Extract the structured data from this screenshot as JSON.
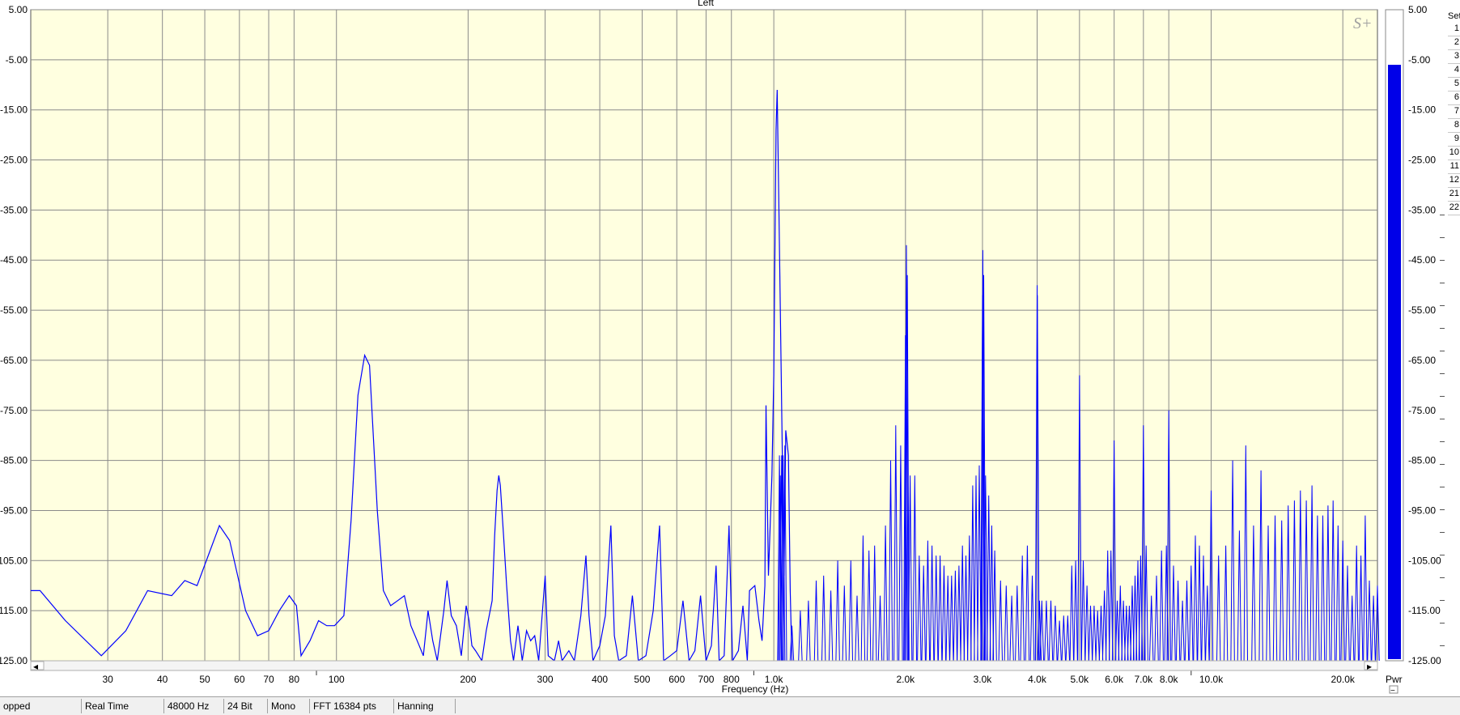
{
  "window": {
    "channel_title": "Left"
  },
  "logo": {
    "text": "S+"
  },
  "set_panel": {
    "label": "Set",
    "buttons": [
      "1",
      "2",
      "3",
      "4",
      "5",
      "6",
      "7",
      "8",
      "9",
      "10",
      "11",
      "12",
      "21",
      "22"
    ]
  },
  "meter": {
    "label": "Pwr",
    "level_db": -6.0,
    "collapse_glyph": "−"
  },
  "scroll": {
    "left_arrow": "◂",
    "right_arrow": "▸"
  },
  "status": {
    "segments": [
      "opped",
      "Real Time",
      "48000 Hz",
      "24 Bit",
      "Mono",
      "FFT 16384 pts",
      "Hanning"
    ]
  },
  "colors": {
    "plot_bg": "#ffffe0",
    "trace": "#0000ff",
    "grid": "#8a8a8a",
    "meter_fill": "#0000e8"
  },
  "chart_data": {
    "type": "line",
    "title": "Left",
    "xlabel": "Frequency (Hz)",
    "ylabel": "",
    "x_scale": "log",
    "xlim": [
      20,
      24000
    ],
    "ylim": [
      -125,
      5
    ],
    "x_ticks": [
      {
        "v": 30,
        "t": "30"
      },
      {
        "v": 40,
        "t": "40"
      },
      {
        "v": 50,
        "t": "50"
      },
      {
        "v": 60,
        "t": "60"
      },
      {
        "v": 70,
        "t": "70"
      },
      {
        "v": 80,
        "t": "80"
      },
      {
        "v": 100,
        "t": "100"
      },
      {
        "v": 200,
        "t": "200"
      },
      {
        "v": 300,
        "t": "300"
      },
      {
        "v": 400,
        "t": "400"
      },
      {
        "v": 500,
        "t": "500"
      },
      {
        "v": 600,
        "t": "600"
      },
      {
        "v": 700,
        "t": "700"
      },
      {
        "v": 800,
        "t": "800"
      },
      {
        "v": 1000,
        "t": "1.0k"
      },
      {
        "v": 2000,
        "t": "2.0k"
      },
      {
        "v": 3000,
        "t": "3.0k"
      },
      {
        "v": 4000,
        "t": "4.0k"
      },
      {
        "v": 5000,
        "t": "5.0k"
      },
      {
        "v": 6000,
        "t": "6.0k"
      },
      {
        "v": 7000,
        "t": "7.0k"
      },
      {
        "v": 8000,
        "t": "8.0k"
      },
      {
        "v": 10000,
        "t": "10.0k"
      },
      {
        "v": 20000,
        "t": "20.0k"
      }
    ],
    "x_minor": [
      90,
      900,
      9000
    ],
    "y_ticks": [
      {
        "v": 5,
        "t": "5.00"
      },
      {
        "v": -5,
        "t": "-5.00"
      },
      {
        "v": -15,
        "t": "-15.00"
      },
      {
        "v": -25,
        "t": "-25.00"
      },
      {
        "v": -35,
        "t": "-35.00"
      },
      {
        "v": -45,
        "t": "-45.00"
      },
      {
        "v": -55,
        "t": "-55.00"
      },
      {
        "v": -65,
        "t": "-65.00"
      },
      {
        "v": -75,
        "t": "-75.00"
      },
      {
        "v": -85,
        "t": "-85.00"
      },
      {
        "v": -95,
        "t": "-95.00"
      },
      {
        "v": -105,
        "t": "-105.00"
      },
      {
        "v": -115,
        "t": "-115.00"
      },
      {
        "v": -125,
        "t": "-125.00"
      }
    ],
    "grid": true,
    "series": [
      {
        "points": [
          [
            20,
            -111
          ],
          [
            21,
            -111
          ],
          [
            24,
            -117
          ],
          [
            29,
            -124
          ],
          [
            33,
            -119
          ],
          [
            37,
            -111
          ],
          [
            42,
            -112
          ],
          [
            45,
            -109
          ],
          [
            48,
            -110
          ],
          [
            54,
            -98
          ],
          [
            57,
            -101
          ],
          [
            62,
            -115
          ],
          [
            66,
            -120
          ],
          [
            70,
            -119
          ],
          [
            74,
            -115
          ],
          [
            78,
            -112
          ],
          [
            81,
            -114
          ],
          [
            83,
            -124
          ],
          [
            87,
            -121
          ],
          [
            91,
            -117
          ],
          [
            95,
            -118
          ],
          [
            99,
            -118
          ],
          [
            104,
            -116
          ],
          [
            108,
            -97
          ],
          [
            112,
            -72
          ],
          [
            116,
            -64
          ],
          [
            119,
            -66
          ],
          [
            124,
            -95
          ],
          [
            128,
            -111
          ],
          [
            133,
            -114
          ],
          [
            138,
            -113
          ],
          [
            143,
            -112
          ],
          [
            148,
            -118
          ],
          [
            153,
            -121
          ],
          [
            158,
            -124
          ],
          [
            162,
            -115
          ],
          [
            166,
            -121
          ],
          [
            170,
            -125
          ],
          [
            176,
            -115
          ],
          [
            179,
            -109
          ],
          [
            183,
            -116
          ],
          [
            188,
            -118
          ],
          [
            193,
            -124
          ],
          [
            198,
            -114
          ],
          [
            201,
            -117
          ],
          [
            204,
            -122
          ],
          [
            208,
            -123
          ],
          [
            215,
            -125
          ],
          [
            220,
            -119
          ],
          [
            227,
            -113
          ],
          [
            230,
            -100
          ],
          [
            233,
            -91
          ],
          [
            235,
            -88
          ],
          [
            237,
            -90
          ],
          [
            241,
            -100
          ],
          [
            245,
            -110
          ],
          [
            250,
            -121
          ],
          [
            254,
            -125
          ],
          [
            260,
            -118
          ],
          [
            266,
            -125
          ],
          [
            272,
            -119
          ],
          [
            278,
            -121
          ],
          [
            284,
            -120
          ],
          [
            290,
            -125
          ],
          [
            300,
            -108
          ],
          [
            305,
            -124
          ],
          [
            315,
            -125
          ],
          [
            322,
            -121
          ],
          [
            328,
            -125
          ],
          [
            340,
            -123
          ],
          [
            350,
            -125
          ],
          [
            362,
            -116
          ],
          [
            372,
            -104
          ],
          [
            378,
            -116
          ],
          [
            386,
            -125
          ],
          [
            400,
            -122
          ],
          [
            412,
            -116
          ],
          [
            424,
            -98
          ],
          [
            432,
            -120
          ],
          [
            442,
            -125
          ],
          [
            460,
            -124
          ],
          [
            475,
            -112
          ],
          [
            490,
            -125
          ],
          [
            510,
            -124
          ],
          [
            530,
            -115
          ],
          [
            548,
            -98
          ],
          [
            560,
            -125
          ],
          [
            580,
            -124
          ],
          [
            600,
            -123
          ],
          [
            620,
            -113
          ],
          [
            640,
            -125
          ],
          [
            660,
            -123
          ],
          [
            680,
            -112
          ],
          [
            700,
            -125
          ],
          [
            720,
            -122
          ],
          [
            738,
            -106
          ],
          [
            750,
            -125
          ],
          [
            770,
            -124
          ],
          [
            790,
            -98
          ],
          [
            805,
            -125
          ],
          [
            830,
            -123
          ],
          [
            850,
            -114
          ],
          [
            870,
            -125
          ],
          [
            880,
            -111
          ],
          [
            905,
            -110
          ],
          [
            925,
            -117
          ],
          [
            940,
            -121
          ],
          [
            954,
            -110
          ],
          [
            960,
            -74
          ],
          [
            972,
            -108
          ],
          [
            990,
            -88
          ],
          [
            1000,
            -68
          ],
          [
            1012,
            -19
          ],
          [
            1018,
            -11
          ],
          [
            1026,
            -32
          ],
          [
            1040,
            -68
          ],
          [
            1055,
            -108
          ],
          [
            1065,
            -79
          ],
          [
            1080,
            -84
          ],
          [
            1090,
            -111
          ],
          [
            1100,
            -125
          ]
        ],
        "peaks": [
          [
            1030,
            -84
          ],
          [
            1035,
            -88
          ],
          [
            1042,
            -84
          ],
          [
            1050,
            -84
          ],
          [
            1060,
            -82
          ],
          [
            1100,
            -118
          ],
          [
            1150,
            -115
          ],
          [
            1200,
            -113
          ],
          [
            1250,
            -109
          ],
          [
            1300,
            -108
          ],
          [
            1350,
            -111
          ],
          [
            1400,
            -105
          ],
          [
            1450,
            -110
          ],
          [
            1500,
            -105
          ],
          [
            1550,
            -112
          ],
          [
            1600,
            -100
          ],
          [
            1650,
            -103
          ],
          [
            1700,
            -102
          ],
          [
            1750,
            -112
          ],
          [
            1800,
            -98
          ],
          [
            1850,
            -85
          ],
          [
            1900,
            -78
          ],
          [
            1950,
            -82
          ],
          [
            2000,
            -60
          ],
          [
            2010,
            -42
          ],
          [
            2020,
            -48
          ],
          [
            2050,
            -88
          ],
          [
            2100,
            -88
          ],
          [
            2150,
            -104
          ],
          [
            2200,
            -106
          ],
          [
            2250,
            -101
          ],
          [
            2300,
            -102
          ],
          [
            2350,
            -104
          ],
          [
            2400,
            -104
          ],
          [
            2450,
            -106
          ],
          [
            2500,
            -108
          ],
          [
            2550,
            -108
          ],
          [
            2600,
            -107
          ],
          [
            2650,
            -106
          ],
          [
            2700,
            -102
          ],
          [
            2750,
            -104
          ],
          [
            2800,
            -100
          ],
          [
            2850,
            -90
          ],
          [
            2900,
            -88
          ],
          [
            2950,
            -86
          ],
          [
            3000,
            -52
          ],
          [
            3005,
            -43
          ],
          [
            3020,
            -48
          ],
          [
            3050,
            -88
          ],
          [
            3100,
            -92
          ],
          [
            3150,
            -98
          ],
          [
            3200,
            -103
          ],
          [
            3300,
            -109
          ],
          [
            3400,
            -110
          ],
          [
            3500,
            -112
          ],
          [
            3600,
            -110
          ],
          [
            3700,
            -104
          ],
          [
            3800,
            -102
          ],
          [
            3900,
            -108
          ],
          [
            4000,
            -50
          ],
          [
            4005,
            -52
          ],
          [
            4050,
            -113
          ],
          [
            4100,
            -113
          ],
          [
            4200,
            -113
          ],
          [
            4300,
            -113
          ],
          [
            4400,
            -114
          ],
          [
            4500,
            -117
          ],
          [
            4600,
            -116
          ],
          [
            4700,
            -116
          ],
          [
            4800,
            -106
          ],
          [
            4900,
            -105
          ],
          [
            5000,
            -68
          ],
          [
            5100,
            -105
          ],
          [
            5200,
            -110
          ],
          [
            5300,
            -114
          ],
          [
            5400,
            -114
          ],
          [
            5500,
            -115
          ],
          [
            5600,
            -114
          ],
          [
            5700,
            -111
          ],
          [
            5800,
            -103
          ],
          [
            5900,
            -103
          ],
          [
            6000,
            -81
          ],
          [
            6100,
            -113
          ],
          [
            6200,
            -110
          ],
          [
            6300,
            -113
          ],
          [
            6400,
            -114
          ],
          [
            6500,
            -114
          ],
          [
            6600,
            -110
          ],
          [
            6700,
            -108
          ],
          [
            6800,
            -105
          ],
          [
            6900,
            -104
          ],
          [
            7000,
            -78
          ],
          [
            7100,
            -102
          ],
          [
            7300,
            -112
          ],
          [
            7500,
            -108
          ],
          [
            7700,
            -103
          ],
          [
            7900,
            -102
          ],
          [
            8000,
            -75
          ],
          [
            8200,
            -106
          ],
          [
            8400,
            -109
          ],
          [
            8600,
            -113
          ],
          [
            8800,
            -109
          ],
          [
            9000,
            -106
          ],
          [
            9200,
            -100
          ],
          [
            9400,
            -102
          ],
          [
            9600,
            -104
          ],
          [
            9800,
            -110
          ],
          [
            10000,
            -91
          ],
          [
            10400,
            -104
          ],
          [
            10800,
            -102
          ],
          [
            11200,
            -85
          ],
          [
            11600,
            -99
          ],
          [
            12000,
            -82
          ],
          [
            12500,
            -98
          ],
          [
            13000,
            -87
          ],
          [
            13500,
            -98
          ],
          [
            14000,
            -96
          ],
          [
            14500,
            -97
          ],
          [
            15000,
            -94
          ],
          [
            15500,
            -93
          ],
          [
            16000,
            -91
          ],
          [
            16500,
            -93
          ],
          [
            17000,
            -90
          ],
          [
            17500,
            -96
          ],
          [
            18000,
            -96
          ],
          [
            18500,
            -94
          ],
          [
            19000,
            -93
          ],
          [
            19500,
            -98
          ],
          [
            20000,
            -101
          ],
          [
            20500,
            -106
          ],
          [
            21000,
            -112
          ],
          [
            21500,
            -102
          ],
          [
            22000,
            -104
          ],
          [
            22500,
            -96
          ],
          [
            23000,
            -109
          ],
          [
            23500,
            -112
          ],
          [
            24000,
            -110
          ]
        ]
      }
    ]
  }
}
